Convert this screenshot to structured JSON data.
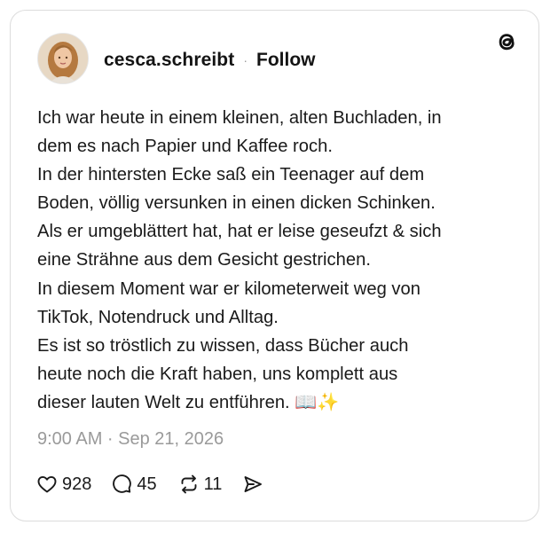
{
  "post": {
    "username": "cesca.schreibt",
    "separator": "·",
    "follow_label": "Follow",
    "lines": [
      "Ich war heute in einem kleinen, alten Buchladen, in",
      "dem es nach Papier und Kaffee roch.",
      "In der hintersten Ecke saß ein Teenager auf dem",
      "Boden, völlig versunken in einen dicken Schinken.",
      "Als er umgeblättert hat, hat er leise geseufzt & sich",
      "eine Strähne aus dem Gesicht gestrichen.",
      "In diesem Moment war er kilometerweit weg von",
      "TikTok, Notendruck und Alltag.",
      "Es ist so tröstlich zu wissen, dass Bücher auch",
      "heute noch die Kraft haben, uns komplett aus",
      "dieser lauten Welt zu entführen. 📖✨"
    ],
    "timestamp": "9:00 AM · Sep 21, 2026"
  },
  "stats": {
    "likes": "928",
    "replies": "45",
    "reposts": "11"
  },
  "icons": {
    "logo": "threads-logo-icon",
    "like": "heart-icon",
    "reply": "comment-icon",
    "repost": "repost-icon",
    "share": "send-icon"
  },
  "colors": {
    "text": "#1a1a1a",
    "muted": "#9a9a9a",
    "border": "#dcdcdc"
  }
}
